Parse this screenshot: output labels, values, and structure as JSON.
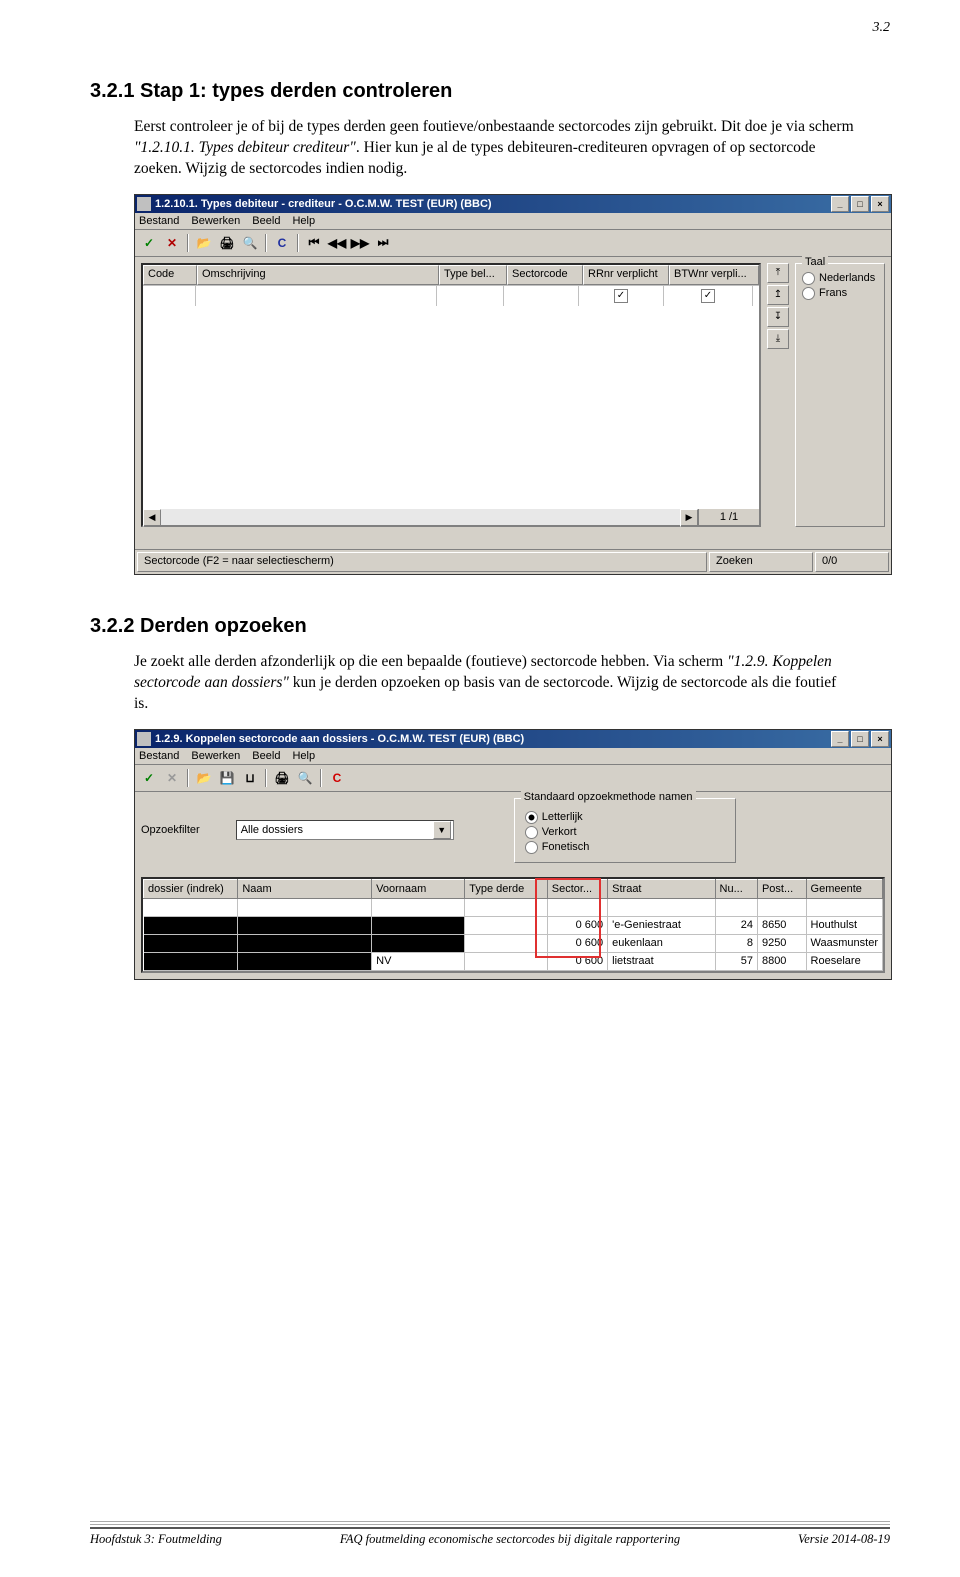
{
  "page_corner": "3.2",
  "section1": {
    "heading": "3.2.1 Stap 1: types derden controleren",
    "p1a": "Eerst controleer je of bij de types derden geen foutieve/onbestaande sectorcodes zijn gebruikt. Dit doe je via scherm ",
    "p1i": "\"1.2.10.1. Types debiteur crediteur\"",
    "p1b": ". Hier kun je al de types debiteuren-crediteuren opvragen of op sectorcode zoeken. Wijzig de sectorcodes indien nodig."
  },
  "screenshot1": {
    "title": "1.2.10.1. Types debiteur - crediteur - O.C.M.W. TEST (EUR) (BBC)",
    "menus": [
      "Bestand",
      "Bewerken",
      "Beeld",
      "Help"
    ],
    "columns": [
      "Code",
      "Omschrijving",
      "Type bel...",
      "Sectorcode",
      "RRnr verplicht",
      "BTWnr verpli..."
    ],
    "taal_legend": "Taal",
    "taal_options": [
      "Nederlands",
      "Frans"
    ],
    "status_left": "Sectorcode (F2 = naar selectiescherm)",
    "status_mid": "Zoeken",
    "status_right": "0/0",
    "record_counter": "1 /1"
  },
  "section2": {
    "heading": "3.2.2 Derden opzoeken",
    "p1a": "Je zoekt alle derden afzonderlijk op die een bepaalde (foutieve) sectorcode hebben. Via scherm ",
    "p1i": "\"1.2.9. Koppelen sectorcode aan dossiers\"",
    "p1b": " kun je derden opzoeken op basis van de sectorcode. Wijzig de sectorcode als die foutief is."
  },
  "screenshot2": {
    "title": "1.2.9. Koppelen sectorcode aan dossiers - O.C.M.W. TEST (EUR) (BBC)",
    "menus": [
      "Bestand",
      "Bewerken",
      "Beeld",
      "Help"
    ],
    "filter_label": "Opzoekfilter",
    "filter_value": "Alle dossiers",
    "group_legend": "Standaard opzoekmethode namen",
    "group_options": [
      "Letterlijk",
      "Verkort",
      "Fonetisch"
    ],
    "columns": [
      "dossier (indrek)",
      "Naam",
      "Voornaam",
      "Type derde",
      "Sector...",
      "Straat",
      "Nu...",
      "Post...",
      "Gemeente"
    ],
    "rows": [
      {
        "dossier": "",
        "naam": "",
        "voornaam": "",
        "type": "",
        "sector": "0 600",
        "straat": "'e-Geniestraat",
        "nu": "24",
        "post": "8650",
        "gemeente": "Houthulst"
      },
      {
        "dossier": "",
        "naam": "",
        "voornaam": "",
        "type": "",
        "sector": "0 600",
        "straat": "eukenlaan",
        "nu": "8",
        "post": "9250",
        "gemeente": "Waasmunster"
      },
      {
        "dossier": "",
        "naam": "",
        "voornaam": "NV",
        "type": "",
        "sector": "0 600",
        "straat": "lietstraat",
        "nu": "57",
        "post": "8800",
        "gemeente": "Roeselare"
      }
    ]
  },
  "footer": {
    "left": "Hoofdstuk 3: Foutmelding",
    "center": "FAQ foutmelding economische sectorcodes bij digitale rapportering",
    "right": "Versie 2014-08-19"
  }
}
